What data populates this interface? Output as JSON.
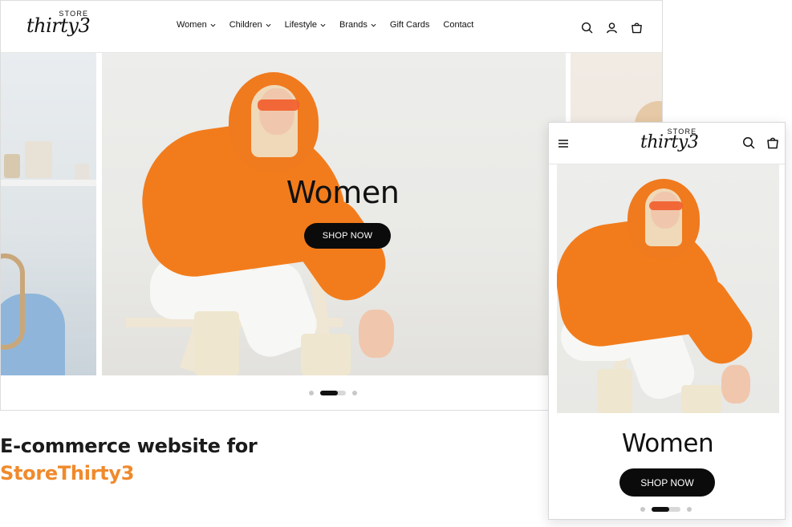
{
  "desktop": {
    "logo": {
      "top": "STORE",
      "word": "thirty3"
    },
    "nav": [
      {
        "label": "Women",
        "has_dropdown": true
      },
      {
        "label": "Children",
        "has_dropdown": true
      },
      {
        "label": "Lifestyle",
        "has_dropdown": true
      },
      {
        "label": "Brands",
        "has_dropdown": true
      },
      {
        "label": "Gift Cards",
        "has_dropdown": false
      },
      {
        "label": "Contact",
        "has_dropdown": false
      }
    ],
    "icons": [
      "search-icon",
      "user-icon",
      "bag-icon"
    ],
    "hero": {
      "title": "Women",
      "button": "SHOP NOW"
    },
    "carousel": {
      "slides": 3,
      "active": 2
    }
  },
  "caption": {
    "line1": "E-commerce website for",
    "line2": "StoreThirty3"
  },
  "mobile": {
    "logo": {
      "top": "STORE",
      "word": "thirty3"
    },
    "icons": [
      "menu-icon",
      "search-icon",
      "bag-icon"
    ],
    "hero": {
      "title": "Women",
      "button": "SHOP NOW"
    },
    "carousel": {
      "slides": 3,
      "active": 2
    }
  },
  "colors": {
    "accent": "#f08a2c",
    "button": "#0b0b0b",
    "text": "#1b1b1b"
  }
}
